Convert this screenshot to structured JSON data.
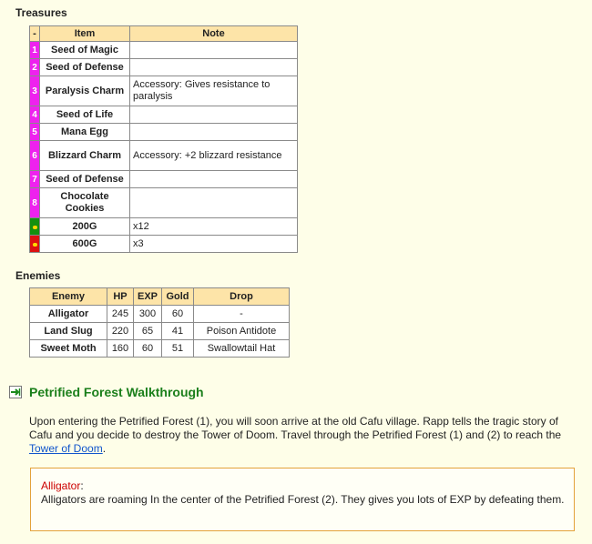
{
  "treasures": {
    "heading": "Treasures",
    "columns": [
      "-",
      "Item",
      "Note"
    ],
    "rows": [
      {
        "mark": "1",
        "kind": "num",
        "item": "Seed of Magic",
        "note": ""
      },
      {
        "mark": "2",
        "kind": "num",
        "item": "Seed of Defense",
        "note": ""
      },
      {
        "mark": "3",
        "kind": "num",
        "item": "Paralysis Charm",
        "note": "Accessory: Gives resistance to paralysis"
      },
      {
        "mark": "4",
        "kind": "num",
        "item": "Seed of Life",
        "note": ""
      },
      {
        "mark": "5",
        "kind": "num",
        "item": "Mana Egg",
        "note": ""
      },
      {
        "mark": "6",
        "kind": "num",
        "item": "Blizzard Charm",
        "note": "Accessory: +2 blizzard resistance"
      },
      {
        "mark": "7",
        "kind": "num",
        "item": "Seed of Defense",
        "note": ""
      },
      {
        "mark": "8",
        "kind": "num",
        "item": "Chocolate Cookies",
        "note": ""
      },
      {
        "mark": "",
        "kind": "green",
        "item": "200G",
        "note": "x12"
      },
      {
        "mark": "",
        "kind": "red",
        "item": "600G",
        "note": "x3"
      }
    ]
  },
  "enemies": {
    "heading": "Enemies",
    "columns": [
      "Enemy",
      "HP",
      "EXP",
      "Gold",
      "Drop"
    ],
    "rows": [
      [
        "Alligator",
        "245",
        "300",
        "60",
        "-"
      ],
      [
        "Land Slug",
        "220",
        "65",
        "41",
        "Poison Antidote"
      ],
      [
        "Sweet Moth",
        "160",
        "60",
        "51",
        "Swallowtail Hat"
      ]
    ]
  },
  "walkthrough": {
    "title": "Petrified Forest Walkthrough",
    "text_before": "Upon entering the Petrified Forest (1), you will soon arrive at the old Cafu village. Rapp tells the tragic story of Cafu and you decide to destroy the Tower of Doom. Travel through the Petrified Forest (1) and (2) to reach the ",
    "link": "Tower of Doom",
    "text_after": "."
  },
  "callout": {
    "title": "Alligator",
    "text": "Alligators are roaming In the center of the Petrified Forest (2). They gives you lots of EXP by defeating them."
  },
  "colors": {
    "number_cell": "#ee22ee",
    "gold_green": "#14900f",
    "gold_red": "#dd1111",
    "header": "#fde4a8",
    "title_green": "#1b7f1b",
    "callout_border": "#e3a23a",
    "callout_title": "#cc0000"
  }
}
